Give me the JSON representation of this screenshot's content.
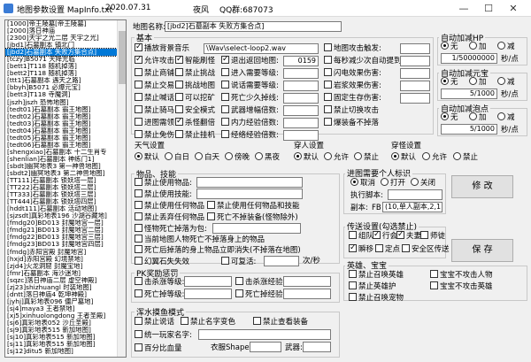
{
  "window": {
    "title": "地图参数设置 MapInfo.txt",
    "date": "2020.07.31",
    "brand": "夜风",
    "qq": "QQ群:687073",
    "minimize": "—",
    "maximize": "☐",
    "close": "✕"
  },
  "map_list": [
    "[1000]帝王陵墓[帝王陵墓]",
    "[2000]落日神庙 ",
    "[2300]天宇之光二层 天宇之光]",
    "[jbd1]石墓副本 镇北门",
    "[jbd2]石墓副本 失败方集合点]",
    "[tczy]B5071 天降光临",
    "[bett1]T118 随机掉落]",
    "[bett2]T118 随机掉落]",
    "[ttt1]石墓副本 遇天之路]",
    "[bbyh]B5071 必爆元宝]",
    "[bett3]T118 寺魔洞]",
    "[jszh]jszh 恐怖地图]",
    "[tedt01]石墓副本 霸王地图]",
    "[tedt02]石墓副本 霸王地图]",
    "[tedt03]石墓副本 霸王地图]",
    "[tedt04]石墓副本 霸王地图]",
    "[tedt05]石墓副本 霸王地图]",
    "[tedt06]石墓副本 霸王地图]",
    "[shengxiao]石墓副本 十二生肖专",
    "[shenlian]石墓副本 神练门1]",
    "[sbdt]幽冥地表3 第一神兽地图]",
    "[sbdt2]幽冥地表3 第二神兽地图]",
    "[TT111]石墓副本 锁妖塔一层]",
    "[TT222]石墓副本 锁妖塔二层]",
    "[TT333]石墓副本 锁妖塔三层]",
    "[TT444]石墓副本 锁妖塔四层]",
    "[hddt111]石墓副本 活动地图]",
    "[sjzsdt]真彩地表196 沙湖谷藏地]",
    "[fmdg20]BD013 封魔地宫一层]",
    "[fmdg21]BD013 封魔地宫二层]",
    "[fmdg22]BD013 封魔地宫三层]",
    "[fmdg23]BD013 封魔地宫四层]",
    "[fmdg]赤阳宫殿 封魔地宫]",
    "[hxjd]赤阳宫殿 幻境禁地]",
    "[zjd4]火龙洞窟 封魔宝地]",
    "[fmr]石墓副本 海沙迷地]",
    "[sqzc]落日神庙二层 虚空神殿]",
    "[zj23]shizhuangl 时装地图]",
    "[dntt]落日神庙4 乾坤神殿]",
    "[jyhj]真彩地表096 僵尸墓地]",
    "[sj4]maya3 王者禁地]",
    "[xj5]xinhuolongdong 王者圣殿]",
    "[sj6]真彩地表052 沙丘圣殿]",
    "[sj9]真彩地表515 新加地图]",
    "[sj10]真彩地表515 新加地图]",
    "[sj11]真彩地表515 新加地图]",
    "[sj12]ditu5 新加地图]"
  ],
  "form": {
    "map_name_label": "地图名称:",
    "map_name_value": "[jbd2]石墓副本 失败方集合点]",
    "basic_title": "基本",
    "basic_checks": [
      {
        "label": "播放背景音乐",
        "on": true
      },
      {
        "label": "允许攻击",
        "on": true
      },
      {
        "label": "智能刷怪",
        "on": true
      },
      {
        "label": "退出返回地图:",
        "on": true
      },
      {
        "label": "禁止商铺",
        "on": false
      },
      {
        "label": "禁止挑战",
        "on": false
      },
      {
        "label": "进入需要等级:",
        "on": false
      },
      {
        "label": "禁止交易",
        "on": false
      },
      {
        "label": "挑战地图",
        "on": false
      },
      {
        "label": "说话需要等级:",
        "on": false
      },
      {
        "label": "禁止喊话",
        "on": false
      },
      {
        "label": "可以挖矿",
        "on": false
      },
      {
        "label": "死亡少久掉线:",
        "on": false
      },
      {
        "label": "禁止骑马",
        "on": false
      },
      {
        "label": "安全模式",
        "on": false
      },
      {
        "label": "武器增幅倍数:",
        "on": false
      },
      {
        "label": "进图需领",
        "on": false
      },
      {
        "label": "杀怪翻倍",
        "on": true
      },
      {
        "label": "内力经验倍数:",
        "on": false
      },
      {
        "label": "禁止免伤",
        "on": false
      },
      {
        "label": "禁止挂机",
        "on": false
      },
      {
        "label": "经络经验倍数:",
        "on": false
      }
    ],
    "music_value": "\\Wav\\select-loop2.wav",
    "return_map_value": "0159",
    "right_checks": [
      {
        "label": "地图攻击触发:",
        "on": false
      },
      {
        "label": "每秒减少次自动提到时间:",
        "on": false
      },
      {
        "label": "闪电效果伤害:",
        "on": false
      },
      {
        "label": "岩浆效果伤害:",
        "on": false
      },
      {
        "label": "固定生存伤害:",
        "on": false
      },
      {
        "label": "禁止切换攻击",
        "on": false
      },
      {
        "label": "爆装备不掉落",
        "on": false
      }
    ],
    "auto_hp": {
      "title": "自动加减HP",
      "options": [
        "无",
        "加",
        "减"
      ],
      "value": "1/50000000",
      "unit": "秒/点"
    },
    "auto_mp": {
      "title": "自动加减元宝",
      "options": [
        "无",
        "加",
        "减"
      ],
      "value": "5/1000",
      "unit": "秒/点"
    },
    "auto_pt": {
      "title": "自动加减泡点",
      "options": [
        "无",
        "加",
        "减"
      ],
      "value": "5/1000",
      "unit": "秒/点"
    },
    "weather": {
      "title": "天气设置",
      "options": [
        "默认",
        "白日",
        "白天",
        "傍晚",
        "黑夜"
      ]
    },
    "pk": {
      "title": "穿人设置",
      "options": [
        "默认",
        "允许",
        "禁止"
      ]
    },
    "monster": {
      "title": "穿怪设置",
      "options": [
        "默认",
        "允许",
        "禁止"
      ]
    },
    "items": {
      "title": "物品、技能",
      "checks": [
        {
          "label": "禁止使用物品:",
          "on": false
        },
        {
          "label": "禁止使用技能:",
          "on": false
        },
        {
          "label": "禁止使用任何物品",
          "on": false
        },
        {
          "label": "禁止使用任何物品和技能",
          "on": false
        },
        {
          "label": "禁止丢弃任何物品",
          "on": false
        },
        {
          "label": "死亡不掉装备(怪物除外)",
          "on": false
        },
        {
          "label": "怪物死亡掉落为包:",
          "on": false
        },
        {
          "label": "当前地图人物死亡不掉落身上的物品",
          "on": false
        },
        {
          "label": "死亡后掉落的身上物品立即消失(不掉落在地图)",
          "on": false
        },
        {
          "label": "幻翼石失失效",
          "on": false
        },
        {
          "label": "可复活:",
          "on": false
        }
      ],
      "revive_unit": "次/秒"
    },
    "pk_exp": {
      "title": "PK奖励惩罚",
      "checks": [
        {
          "label": "击杀涨等级:",
          "on": false
        },
        {
          "label": "击杀涨经验:",
          "on": false
        },
        {
          "label": "死亡掉等级:",
          "on": false
        },
        {
          "label": "死亡掉经验:",
          "on": false
        }
      ]
    },
    "masked": {
      "title": "浑水摸鱼模式",
      "checks": [
        {
          "label": "禁止说话",
          "on": false
        },
        {
          "label": "禁止名字变色",
          "on": false
        },
        {
          "label": "禁止查看装备",
          "on": false
        },
        {
          "label": "统一玩家名字:",
          "on": false
        },
        {
          "label": "百分比血量",
          "on": false
        }
      ],
      "clothes_label": "衣服Shape:",
      "weapon_label": "武器:"
    },
    "enter_tag": {
      "title": "进图需要个人标识",
      "options": [
        "取消",
        "打开",
        "关闭"
      ],
      "exec_label": "执行脚本:",
      "copy_label": "副本:",
      "copy_prefix": "FB",
      "copy_value": "(10,单人副本,2,1 )"
    },
    "transport": {
      "title": "传送设置(勾选禁止)",
      "checks": [
        {
          "label": "组队",
          "on": false
        },
        {
          "label": "行会",
          "on": true
        },
        {
          "label": "夫妻",
          "on": true
        },
        {
          "label": "师徒",
          "on": false
        },
        {
          "label": "瞬移",
          "on": true
        },
        {
          "label": "定点",
          "on": false
        },
        {
          "label": "安全区传送",
          "on": false
        }
      ]
    },
    "hero": {
      "title": "英雄、宝宝",
      "checks": [
        {
          "label": "禁止召唤英雄",
          "on": false
        },
        {
          "label": "宝宝不攻击人物",
          "on": false
        },
        {
          "label": "禁止英雄护",
          "on": false
        },
        {
          "label": "宝宝不攻击英雄",
          "on": false
        },
        {
          "label": "禁止召唤宠物",
          "on": false
        }
      ]
    },
    "modify_button": "修 改",
    "save_button": "保 存"
  }
}
